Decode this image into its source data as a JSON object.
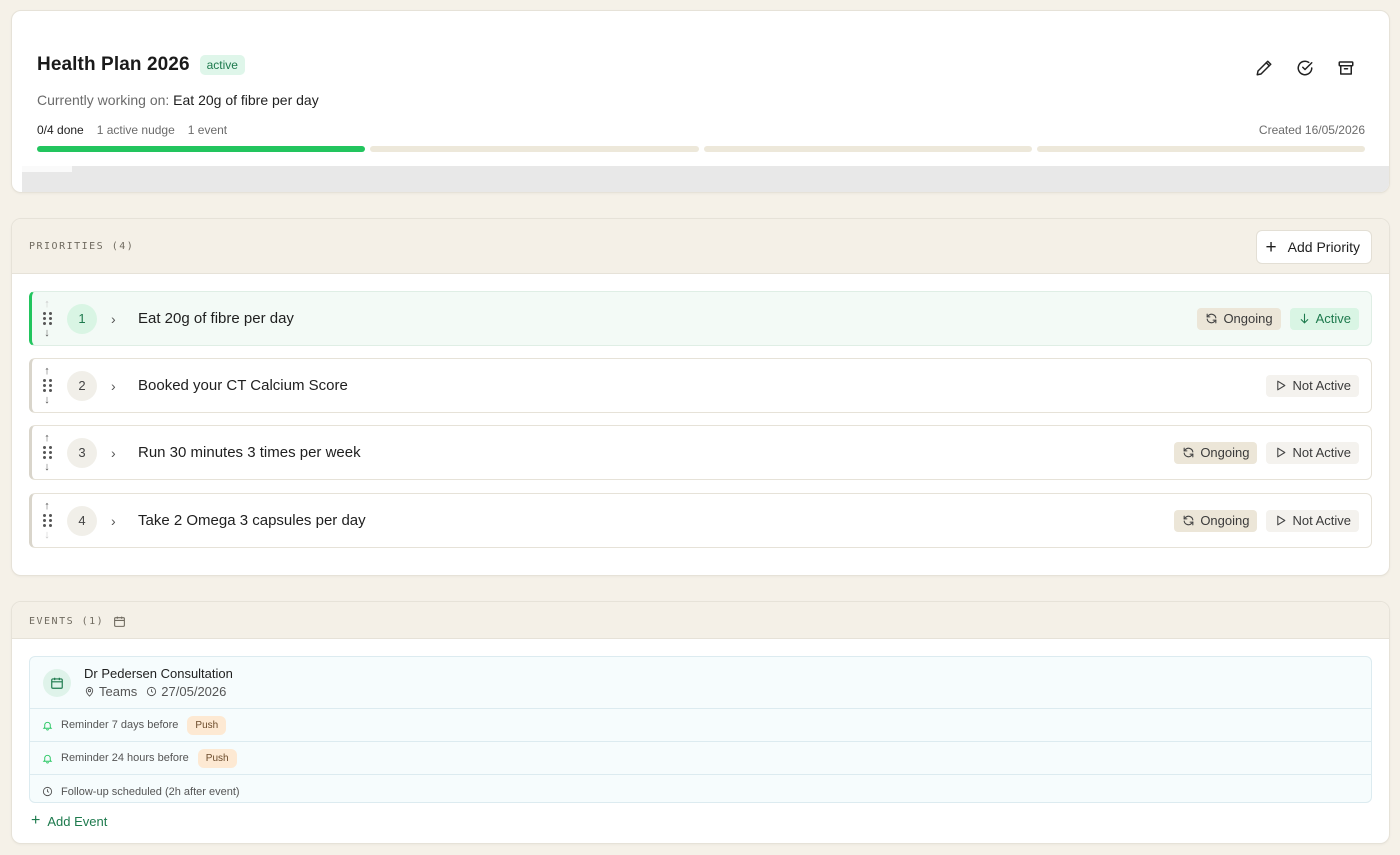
{
  "plan": {
    "title": "Health Plan 2026",
    "status": "active",
    "working_prefix": "Currently working on:",
    "working_on": "Eat 20g of fibre per day",
    "stats": {
      "done": "0/4 done",
      "nudges": "1 active nudge",
      "events": "1 event"
    },
    "created": "Created 16/05/2026",
    "progress_segments": [
      true,
      false,
      false,
      false
    ],
    "actions": {
      "edit": "edit-icon",
      "complete": "check-circle-icon",
      "archive": "archive-icon"
    }
  },
  "priorities": {
    "label": "PRIORITIES (4)",
    "add_label": "Add Priority",
    "items": [
      {
        "num": "1",
        "title": "Eat 20g of fibre per day",
        "ongoing": "Ongoing",
        "state": "Active",
        "active": true
      },
      {
        "num": "2",
        "title": "Booked your CT Calcium Score",
        "ongoing": "",
        "state": "Not Active",
        "active": false
      },
      {
        "num": "3",
        "title": "Run 30 minutes 3 times per week",
        "ongoing": "Ongoing",
        "state": "Not Active",
        "active": false
      },
      {
        "num": "4",
        "title": "Take 2 Omega 3 capsules per day",
        "ongoing": "Ongoing",
        "state": "Not Active",
        "active": false
      }
    ]
  },
  "events": {
    "label": "EVENTS (1)",
    "event": {
      "name": "Dr Pedersen Consultation",
      "location": "Teams",
      "date": "27/05/2026"
    },
    "reminders": [
      {
        "text": "Reminder 7 days before",
        "channel": "Push"
      },
      {
        "text": "Reminder 24 hours before",
        "channel": "Push"
      }
    ],
    "followup": "Follow-up scheduled (2h after event)",
    "add_label": "Add Event"
  },
  "colors": {
    "accent": "#22c55e",
    "accent_text": "#1d7a4d",
    "background": "#f5f1e8"
  }
}
